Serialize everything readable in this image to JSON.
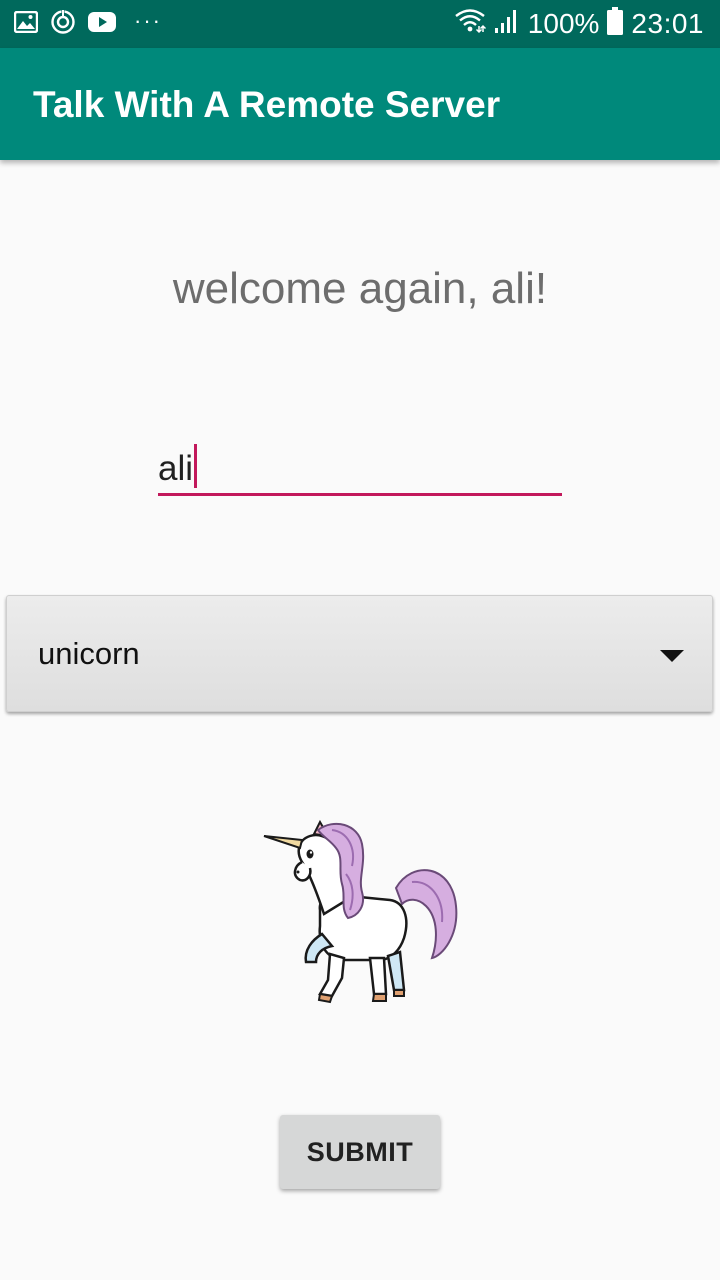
{
  "status_bar": {
    "battery_text": "100%",
    "time": "23:01",
    "more_indicator": "···",
    "icons": [
      "gallery-icon",
      "sync-icon",
      "youtube-icon",
      "wifi-icon",
      "signal-icon",
      "battery-icon"
    ]
  },
  "app_bar": {
    "title": "Talk With A Remote Server",
    "color": "#00897b"
  },
  "main": {
    "welcome_text": "welcome again, ali!",
    "name_input_value": "ali",
    "spinner_selected": "unicorn",
    "image": "unicorn-image",
    "submit_label": "SUBMIT"
  },
  "colors": {
    "status_bar": "#00695c",
    "accent": "#c2185b"
  }
}
